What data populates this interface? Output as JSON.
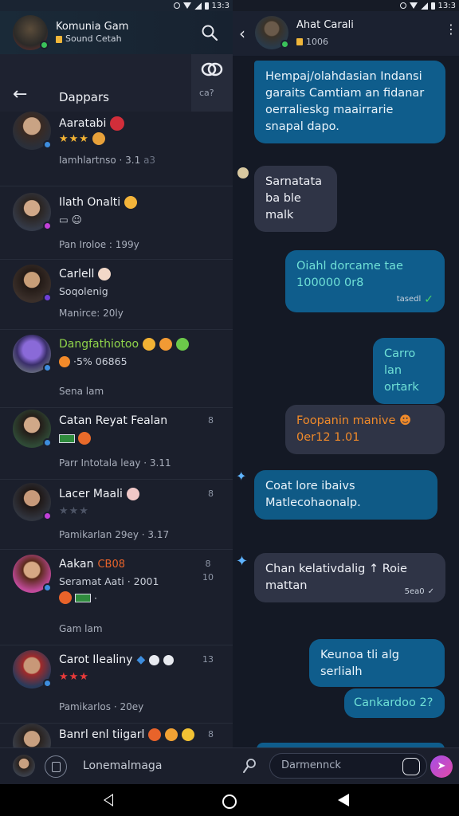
{
  "status_bar": {
    "time": "13:3"
  },
  "left": {
    "header": {
      "title": "Komunia Gam",
      "subtitle": "Sound Cetah"
    },
    "subheader": {
      "title": "Dappars",
      "tool_text": "ca​?"
    },
    "contacts": [
      {
        "name": "Aaratabi",
        "line2_stars": "★★★",
        "meta": "Iamhlartnso · 3.1",
        "meta_extra": "a3"
      },
      {
        "name": "Ilath Onalti",
        "line2_icons": "▭ ☺",
        "meta": "Pan Iroloe : 199y"
      },
      {
        "name": "Carlell",
        "line2": "Soqolenig",
        "meta": "Manirce: 20ly"
      },
      {
        "name": "Dangfathiotoo",
        "line2": "·5% 06865",
        "meta": "Sena lam"
      },
      {
        "name": "Catan Reyat Fealan",
        "meta": "Parr Intotala leay · 3.11",
        "side": "8"
      },
      {
        "name": "Lacer Maali",
        "line2_stars": "★★★",
        "meta": "Pamikarlan 29ey · 3.17",
        "side": "8"
      },
      {
        "name": "Aakan",
        "name_suffix": "CB08",
        "line2": "Seramat Aati · 2001",
        "line3": "·",
        "meta": "Gam lam",
        "side": "8",
        "side2": "10"
      },
      {
        "name": "Carot Ilealiny",
        "line2_stars": "★★★",
        "meta": "Pamikarlos · 20ey",
        "side": "13"
      },
      {
        "name": "Banrl enl tiigarl",
        "line2": "\"\" ⚔",
        "side": "8"
      }
    ]
  },
  "right": {
    "header": {
      "title": "Ahat Carali",
      "subtitle": "1006"
    },
    "messages": [
      {
        "dir": "out",
        "text": "Hempaj/olahdasian Indansi garaits Camtiam an fidanar oerralieskg maairrarie snapal dapo."
      },
      {
        "dir": "in",
        "text": "Sarnatata ba ble malk"
      },
      {
        "dir": "out",
        "text": "Oiahl dorcame tae 100000 0r8",
        "time": "tasedl"
      },
      {
        "dir": "out",
        "text": "Carro lan ortark"
      },
      {
        "dir": "in",
        "text": "Foopanin manive ☻ 0er12 1.01"
      },
      {
        "dir": "in",
        "text": "Coat lore ibaivs Matlecohaonalp."
      },
      {
        "dir": "in",
        "text": "Chan kelativdalig ↑ Roie mattan",
        "time": "5ea0"
      },
      {
        "dir": "out",
        "text": "Keunoa tli alg serlialh"
      },
      {
        "dir": "out",
        "text": "Cankardoo 2?"
      }
    ]
  },
  "bottom": {
    "label": "Lonemalmaga",
    "input_placeholder": "Darmennck"
  }
}
